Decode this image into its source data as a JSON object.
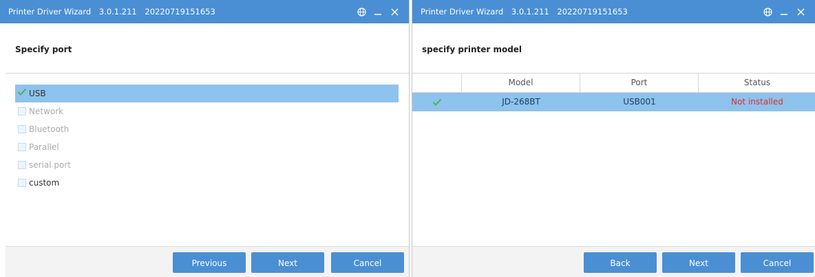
{
  "left_window": {
    "title": {
      "app": "Printer Driver Wizard",
      "version": "3.0.1.211",
      "build": "20220719151653"
    },
    "header": "Specify port",
    "ports": [
      {
        "label": "USB",
        "checked": true,
        "selected": true,
        "enabled": true
      },
      {
        "label": "Network",
        "checked": false,
        "selected": false,
        "enabled": false
      },
      {
        "label": "Bluetooth",
        "checked": false,
        "selected": false,
        "enabled": false
      },
      {
        "label": "Parallel",
        "checked": false,
        "selected": false,
        "enabled": false
      },
      {
        "label": "serial port",
        "checked": false,
        "selected": false,
        "enabled": false
      },
      {
        "label": "custom",
        "checked": false,
        "selected": false,
        "enabled": true
      }
    ],
    "buttons": {
      "previous": "Previous",
      "next": "Next",
      "cancel": "Cancel"
    }
  },
  "right_window": {
    "title": {
      "app": "Printer Driver Wizard",
      "version": "3.0.1.211",
      "build": "20220719151653"
    },
    "header": "specify printer model",
    "table": {
      "columns": [
        "",
        "Model",
        "Port",
        "Status"
      ],
      "rows": [
        {
          "checked": true,
          "model": "JD-268BT",
          "port": "USB001",
          "status": "Not installed"
        }
      ]
    },
    "buttons": {
      "back": "Back",
      "next": "Next",
      "cancel": "Cancel"
    }
  },
  "colors": {
    "titlebar": "#4a8fd4",
    "selection": "#8dc3ec",
    "status_error": "#e52a2a",
    "check": "#4bb34b"
  },
  "icons": [
    "globe-icon",
    "minimize-icon",
    "close-icon",
    "checkbox-checked-icon"
  ]
}
